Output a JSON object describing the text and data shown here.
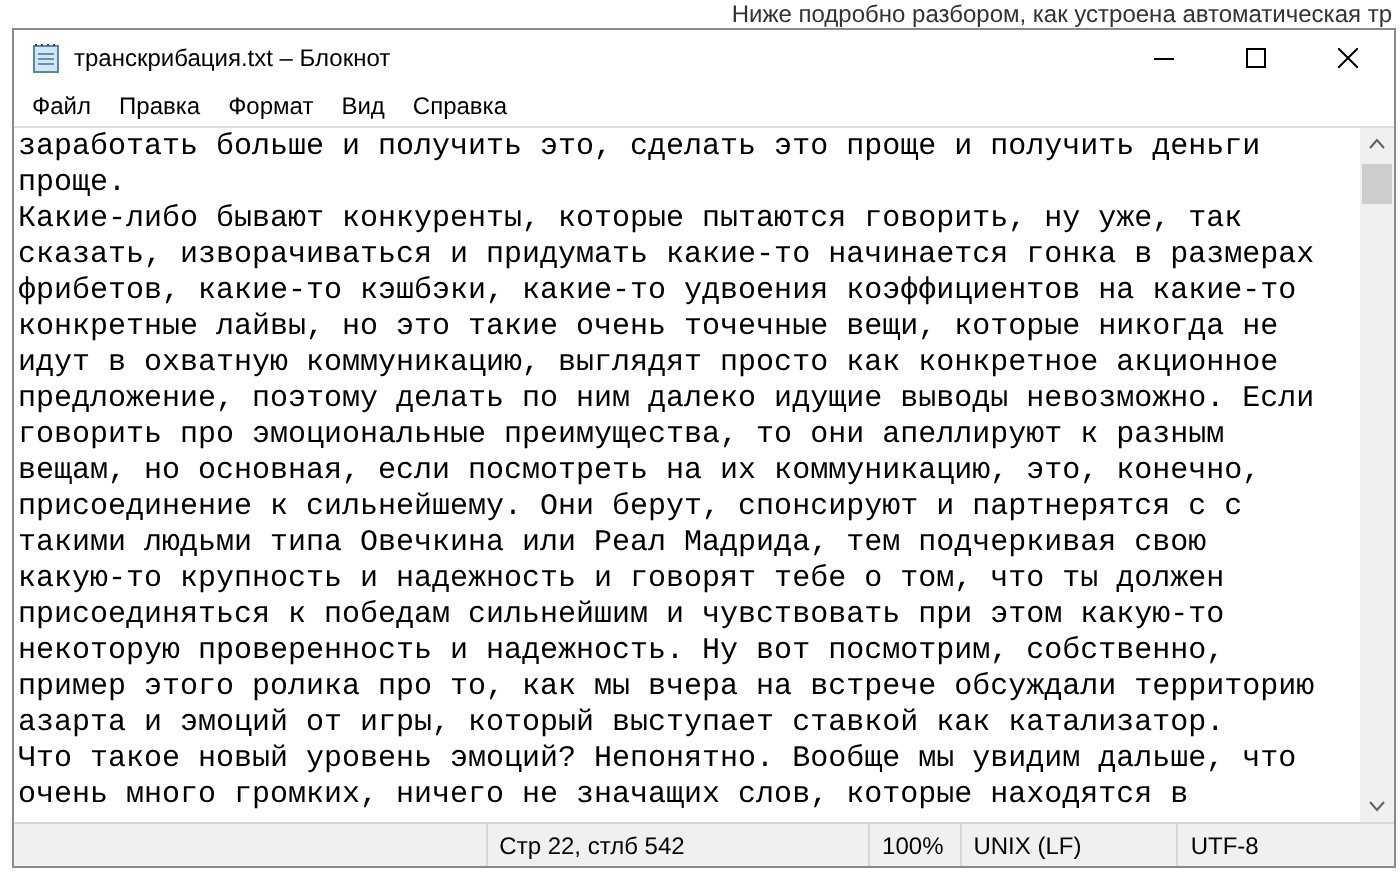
{
  "background_text": "Ниже подробно разбором, как устроена автоматическая тр",
  "window": {
    "title": "транскрибация.txt – Блокнот"
  },
  "menu": [
    "Файл",
    "Правка",
    "Формат",
    "Вид",
    "Справка"
  ],
  "editor": {
    "lines": [
      "заработать больше и получить это, сделать это проще и получить деньги",
      "проще.",
      "Какие-либо бывают конкуренты, которые пытаются говорить, ну уже, так",
      "сказать, изворачиваться и придумать какие-то начинается гонка в размерах",
      "фрибетов, какие-то кэшбэки, какие-то удвоения коэффициентов на какие-то",
      "конкретные лайвы, но это такие очень точечные вещи, которые никогда не",
      "идут в охватную коммуникацию, выглядят просто как конкретное акционное",
      "предложение, поэтому делать по ним далеко идущие выводы невозможно. Если",
      "говорить про эмоциональные преимущества, то они апеллируют к разным",
      "вещам, но основная, если посмотреть на их коммуникацию, это, конечно,",
      "присоединение к сильнейшему. Они берут, спонсируют и партнерятся с с",
      "такими людьми типа Овечкина или Реал Мадрида, тем подчеркивая свою",
      "какую-то крупность и надежность и говорят тебе о том, что ты должен",
      "присоединяться к победам сильнейшим и чувствовать при этом какую-то",
      "некоторую проверенность и надежность. Ну вот посмотрим, собственно,",
      "пример этого ролика про то, как мы вчера на встрече обсуждали территорию",
      "азарта и эмоций от игры, который выступает ставкой как катализатор.",
      "Что такое новый уровень эмоций? Непонятно. Вообще мы увидим дальше, что",
      "очень много громких, ничего не значащих слов, которые находятся в"
    ]
  },
  "status_bar": [
    "Стр 22, стлб 542",
    "100%",
    "UNIX (LF)",
    "UTF-8"
  ]
}
